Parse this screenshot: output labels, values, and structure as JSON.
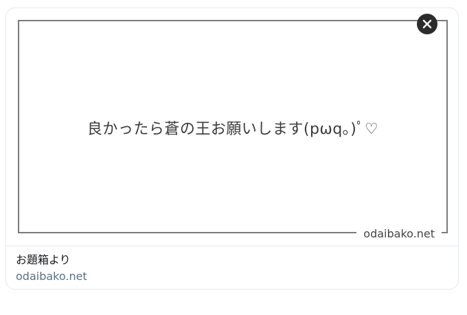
{
  "card": {
    "image": {
      "message": "良かったら蒼の王お願いします(pωq｡)ﾟ♡",
      "watermark": "odaibako.net"
    },
    "close_icon": "close-icon",
    "title": "お題箱より",
    "domain": "odaibako.net"
  }
}
